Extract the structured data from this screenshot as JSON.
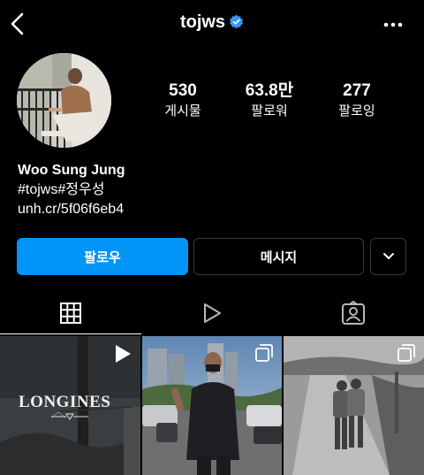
{
  "header": {
    "username": "tojws",
    "icons": {
      "back": "chevron-left-icon",
      "verified": "verified-badge-icon",
      "more": "more-horizontal-icon"
    }
  },
  "profile": {
    "stats": [
      {
        "value": "530",
        "label": "게시물"
      },
      {
        "value": "63.8만",
        "label": "팔로워"
      },
      {
        "value": "277",
        "label": "팔로잉"
      }
    ],
    "name": "Woo Sung Jung",
    "bio_line": "#tojws#정우성",
    "link": "unh.cr/5f06f6eb4"
  },
  "actions": {
    "follow_label": "팔로우",
    "message_label": "메시지",
    "more_icon": "chevron-down-icon"
  },
  "tabs": [
    {
      "icon": "grid-icon",
      "active": true
    },
    {
      "icon": "reels-icon",
      "active": false
    },
    {
      "icon": "tagged-icon",
      "active": false
    }
  ],
  "posts": [
    {
      "type": "reel",
      "badge_icon": "play-icon",
      "logo_text": "LONGINES"
    },
    {
      "type": "carousel",
      "badge_icon": "carousel-icon"
    },
    {
      "type": "carousel",
      "badge_icon": "carousel-icon"
    }
  ],
  "colors": {
    "background": "#000000",
    "accent": "#0095f6",
    "verified": "#3897f0"
  }
}
